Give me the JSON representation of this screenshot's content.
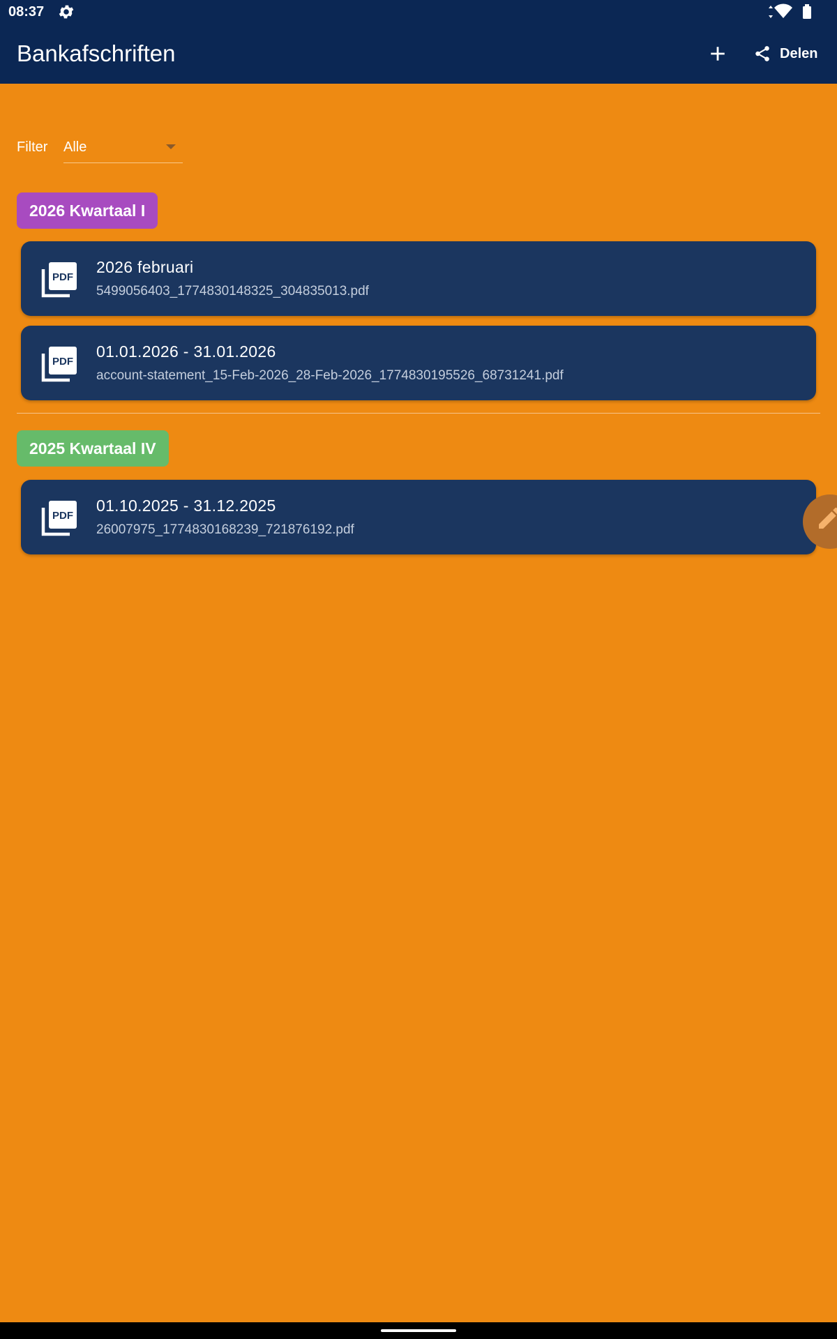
{
  "status_bar": {
    "time": "08:37",
    "icons": [
      "gear-icon",
      "data-arrows-icon",
      "wifi-icon",
      "battery-icon"
    ]
  },
  "app_bar": {
    "title": "Bankafschriften",
    "add_icon": "plus-icon",
    "share_label": "Delen",
    "share_icon": "share-icon"
  },
  "filter": {
    "label": "Filter",
    "selected": "Alle"
  },
  "groups": [
    {
      "title": "2026 Kwartaal I",
      "color": "#a84bc0",
      "items": [
        {
          "title": "2026 februari",
          "file": "5499056403_1774830148325_304835013.pdf",
          "icon": "pdf-icon"
        },
        {
          "title": "01.01.2026 - 31.01.2026",
          "file": "account-statement_15-Feb-2026_28-Feb-2026_1774830195526_68731241.pdf",
          "icon": "pdf-icon"
        }
      ]
    },
    {
      "title": "2025 Kwartaal IV",
      "color": "#66bb6a",
      "items": [
        {
          "title": "01.10.2025 - 31.12.2025",
          "file": "26007975_1774830168239_721876192.pdf",
          "icon": "pdf-icon"
        }
      ]
    }
  ],
  "fab": {
    "icon": "edit-icon"
  },
  "colors": {
    "background": "#ee8a12",
    "app_bar": "#0b2754",
    "card": "#1b365f",
    "card_text": "#ffffff",
    "card_subtext": "#c4cedd"
  }
}
